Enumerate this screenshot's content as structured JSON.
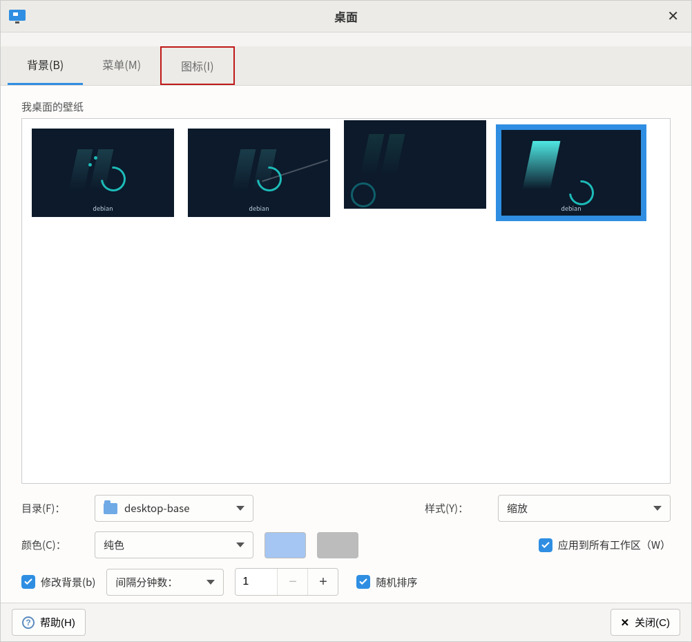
{
  "window": {
    "title": "桌面"
  },
  "tabs": {
    "background": "背景(B)",
    "menu": "菜单(M)",
    "icons": "图标(I)"
  },
  "wallpaper": {
    "section_label": "我桌面的壁纸",
    "brand_text": "debian",
    "selected_index": 3
  },
  "folder": {
    "label": "目录(F)：",
    "value": "desktop-base"
  },
  "style": {
    "label": "样式(Y)：",
    "value": "缩放"
  },
  "color": {
    "label": "颜色(C)：",
    "value": "纯色",
    "swatch1": "#a5c6f2",
    "swatch2": "#bcbcbc"
  },
  "apply_all": {
    "label": "应用到所有工作区（W）",
    "checked": true
  },
  "change_bg": {
    "label": "修改背景(b)",
    "checked": true
  },
  "interval": {
    "label": "间隔分钟数：",
    "value": "1"
  },
  "random": {
    "label": "随机排序",
    "checked": true
  },
  "footer": {
    "help": "帮助(H)",
    "close": "关闭(C)"
  }
}
